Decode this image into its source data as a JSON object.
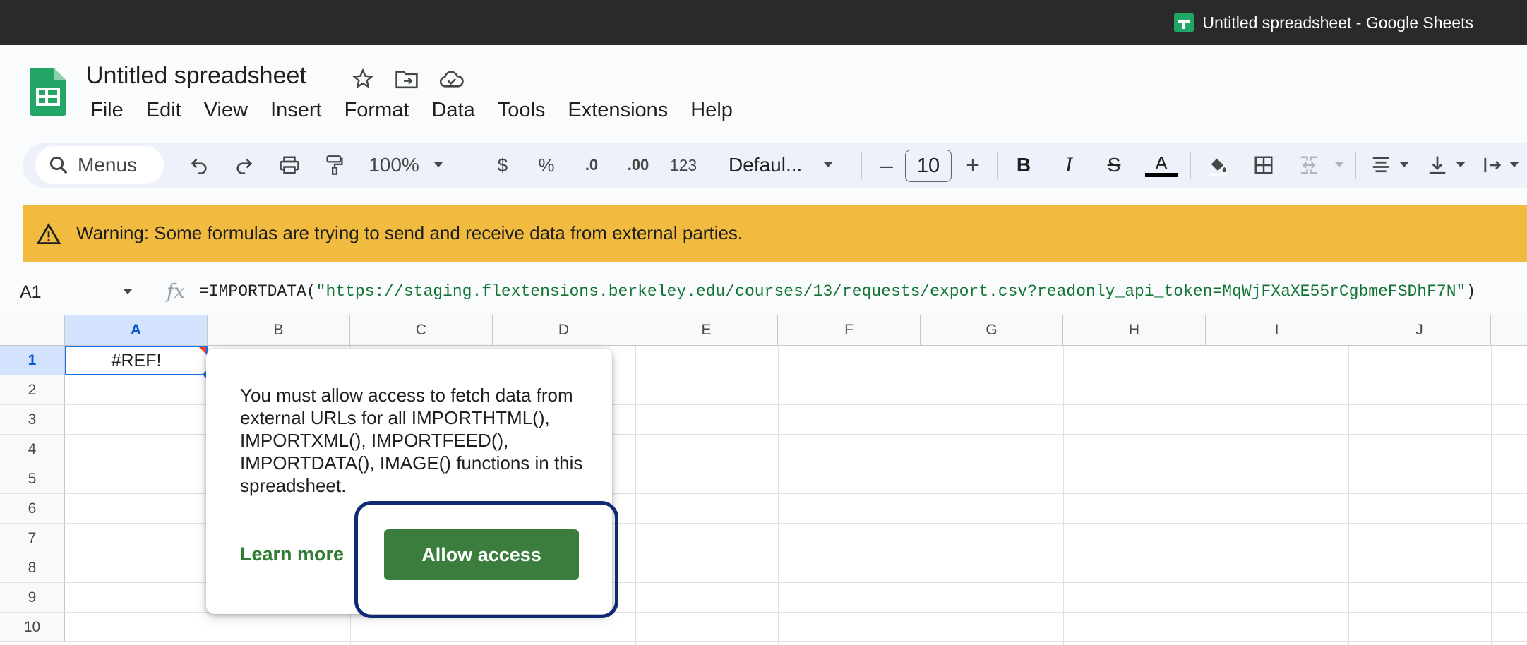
{
  "window": {
    "title": "Untitled spreadsheet - Google Sheets"
  },
  "app": {
    "doc_title": "Untitled spreadsheet",
    "brand_color": "#23a566",
    "header_icons": [
      "star-icon",
      "move-to-folder-icon",
      "cloud-saved-icon"
    ]
  },
  "menu": [
    "File",
    "Edit",
    "View",
    "Insert",
    "Format",
    "Data",
    "Tools",
    "Extensions",
    "Help"
  ],
  "toolbar": {
    "search_label": "Menus",
    "zoom": "100%",
    "currency": "$",
    "percent": "%",
    "dec_decrease": ".0",
    "dec_increase": ".00",
    "more_formats": "123",
    "font": "Defaul...",
    "font_size": "10",
    "minus": "–",
    "plus": "+",
    "bold": "B",
    "italic": "I",
    "strike": "S",
    "text_color_label": "A"
  },
  "warning": {
    "text": "Warning: Some formulas are trying to send and receive data from external parties.",
    "color": "#f1bb3f"
  },
  "formula_bar": {
    "cell_ref": "A1",
    "fx": "fx",
    "formula_prefix": "=IMPORTDATA(",
    "formula_string": "\"https://staging.flextensions.berkeley.edu/courses/13/requests/export.csv?readonly_api_token=MqWjFXaXE55rCgbmeFSDhF7N\"",
    "formula_suffix": ")"
  },
  "grid": {
    "columns": [
      "A",
      "B",
      "C",
      "D",
      "E",
      "F",
      "G",
      "H",
      "I",
      "J"
    ],
    "rows": [
      "1",
      "2",
      "3",
      "4",
      "5",
      "6",
      "7",
      "8",
      "9",
      "10"
    ],
    "a1_value": "#REF!"
  },
  "popup": {
    "message": "You must allow access to fetch data from external URLs for all IMPORTHTML(), IMPORTXML(), IMPORTFEED(), IMPORTDATA(), IMAGE() functions in this spreadsheet.",
    "learn_more": "Learn more",
    "allow": "Allow access"
  }
}
